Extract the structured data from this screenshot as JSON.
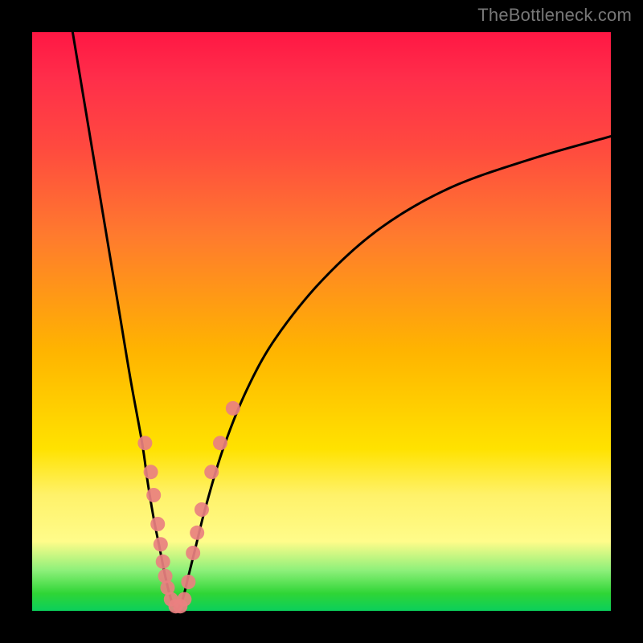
{
  "watermark": "TheBottleneck.com",
  "chart_data": {
    "type": "line",
    "title": "",
    "xlabel": "",
    "ylabel": "",
    "xlim": [
      0,
      100
    ],
    "ylim": [
      0,
      100
    ],
    "series": [
      {
        "name": "left-branch",
        "x": [
          7,
          9,
          11,
          13,
          15,
          17,
          19,
          20,
          21,
          22,
          23,
          24,
          25
        ],
        "y": [
          100,
          88,
          76,
          64,
          52,
          40,
          29,
          22,
          16,
          11,
          6,
          2,
          0
        ]
      },
      {
        "name": "right-branch",
        "x": [
          25,
          26,
          27,
          28,
          30,
          33,
          37,
          42,
          50,
          60,
          72,
          86,
          100
        ],
        "y": [
          0,
          2,
          6,
          10,
          18,
          28,
          38,
          47,
          57,
          66,
          73,
          78,
          82
        ]
      }
    ],
    "markers": {
      "name": "highlighted-points",
      "color": "#e98080",
      "points": [
        {
          "x": 19.5,
          "y": 29
        },
        {
          "x": 20.5,
          "y": 24
        },
        {
          "x": 21.0,
          "y": 20
        },
        {
          "x": 21.7,
          "y": 15
        },
        {
          "x": 22.2,
          "y": 11.5
        },
        {
          "x": 22.6,
          "y": 8.5
        },
        {
          "x": 23.0,
          "y": 6
        },
        {
          "x": 23.4,
          "y": 4
        },
        {
          "x": 24.0,
          "y": 2
        },
        {
          "x": 24.8,
          "y": 0.8
        },
        {
          "x": 25.6,
          "y": 0.8
        },
        {
          "x": 26.3,
          "y": 2
        },
        {
          "x": 27.0,
          "y": 5
        },
        {
          "x": 27.8,
          "y": 10
        },
        {
          "x": 28.5,
          "y": 13.5
        },
        {
          "x": 29.3,
          "y": 17.5
        },
        {
          "x": 31.0,
          "y": 24
        },
        {
          "x": 32.5,
          "y": 29
        },
        {
          "x": 34.7,
          "y": 35
        }
      ]
    }
  }
}
